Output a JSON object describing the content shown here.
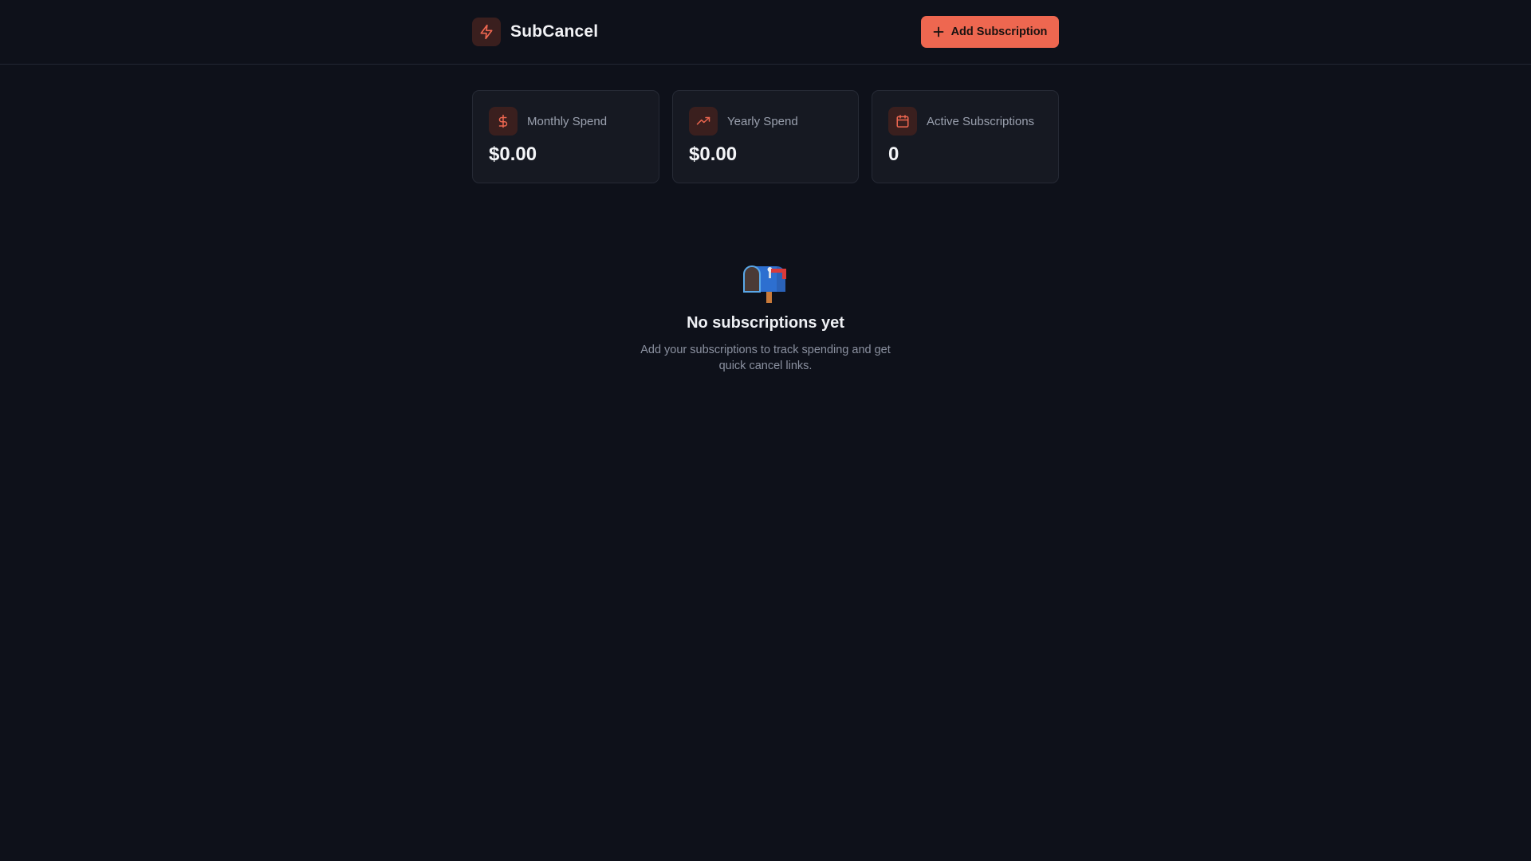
{
  "app": {
    "name": "SubCancel",
    "brand_icon": "lightning-bolt-icon",
    "accent_color": "#ee6750"
  },
  "header": {
    "add_button_label": "Add Subscription",
    "add_button_icon": "plus-icon"
  },
  "stats": [
    {
      "icon": "dollar-sign-icon",
      "label": "Monthly Spend",
      "value": "$0.00"
    },
    {
      "icon": "trending-up-icon",
      "label": "Yearly Spend",
      "value": "$0.00"
    },
    {
      "icon": "calendar-icon",
      "label": "Active Subscriptions",
      "value": "0"
    }
  ],
  "empty_state": {
    "icon": "mailbox-icon",
    "title": "No subscriptions yet",
    "description": "Add your subscriptions to track spending and get quick cancel links."
  }
}
